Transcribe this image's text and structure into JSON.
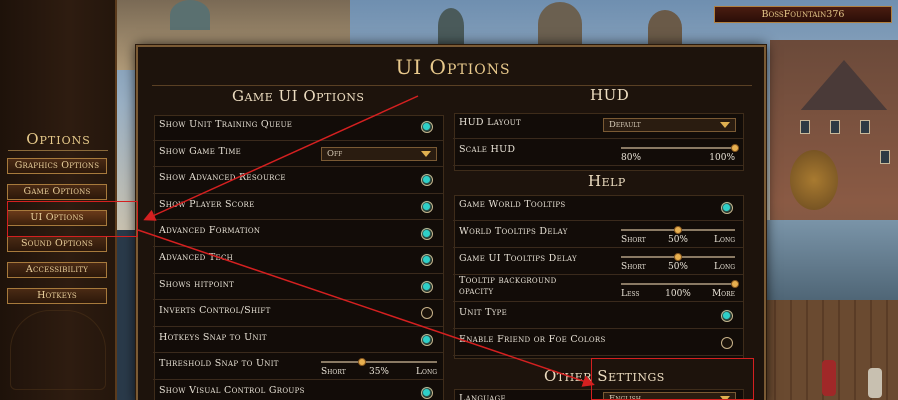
{
  "account": {
    "name": "BossFountain376"
  },
  "sidebar": {
    "title": "Options",
    "items": [
      {
        "label": "Graphics Options"
      },
      {
        "label": "Game Options"
      },
      {
        "label": "UI Options"
      },
      {
        "label": "Sound Options"
      },
      {
        "label": "Accessibility"
      },
      {
        "label": "Hotkeys"
      }
    ]
  },
  "dialog": {
    "title": "UI Options"
  },
  "game_ui": {
    "title": "Game UI Options",
    "rows": [
      {
        "label": "Show Unit Training Queue",
        "type": "radio",
        "checked": true
      },
      {
        "label": "Show Game Time",
        "type": "dropdown",
        "value": "Off"
      },
      {
        "label": "Show Advanced Resource",
        "type": "radio",
        "checked": true
      },
      {
        "label": "Show Player Score",
        "type": "radio",
        "checked": true
      },
      {
        "label": "Advanced Formation",
        "type": "radio",
        "checked": true
      },
      {
        "label": "Advanced Tech",
        "type": "radio",
        "checked": true
      },
      {
        "label": "Shows hitpoint",
        "type": "radio",
        "checked": true
      },
      {
        "label": "Inverts Control/Shift",
        "type": "radio",
        "checked": false
      },
      {
        "label": "Hotkeys Snap to Unit",
        "type": "radio",
        "checked": true
      },
      {
        "label": "Threshold Snap to Unit",
        "type": "slider",
        "min_label": "Short",
        "value_label": "35%",
        "max_label": "Long",
        "value": 0.35
      },
      {
        "label": "Show Visual Control Groups",
        "type": "radio",
        "checked": true
      }
    ]
  },
  "hud": {
    "title": "HUD",
    "rows": [
      {
        "label": "HUD Layout",
        "type": "dropdown",
        "value": "Default"
      },
      {
        "label": "Scale HUD",
        "type": "slider",
        "min_label": "80%",
        "value_label": "",
        "max_label": "100%",
        "value": 1.0
      }
    ]
  },
  "help": {
    "title": "Help",
    "rows": [
      {
        "label": "Game World Tooltips",
        "type": "radio",
        "checked": true
      },
      {
        "label": "World Tooltips Delay",
        "type": "slider",
        "min_label": "Short",
        "value_label": "50%",
        "max_label": "Long",
        "value": 0.5
      },
      {
        "label": "Game UI Tooltips Delay",
        "type": "slider",
        "min_label": "Short",
        "value_label": "50%",
        "max_label": "Long",
        "value": 0.5
      },
      {
        "label": "Tooltip background opacity",
        "type": "slider",
        "min_label": "Less",
        "value_label": "100%",
        "max_label": "More",
        "value": 1.0
      },
      {
        "label": "Unit Type",
        "type": "radio",
        "checked": true
      },
      {
        "label": "Enable Friend or Foe Colors",
        "type": "radio",
        "checked": false
      }
    ]
  },
  "other": {
    "title": "Other Settings",
    "rows": [
      {
        "label": "Language",
        "type": "dropdown",
        "value": "English"
      }
    ]
  },
  "colors": {
    "accent": "#2ed0c8",
    "annotation": "#d42020",
    "gold": "#e8c98c"
  }
}
